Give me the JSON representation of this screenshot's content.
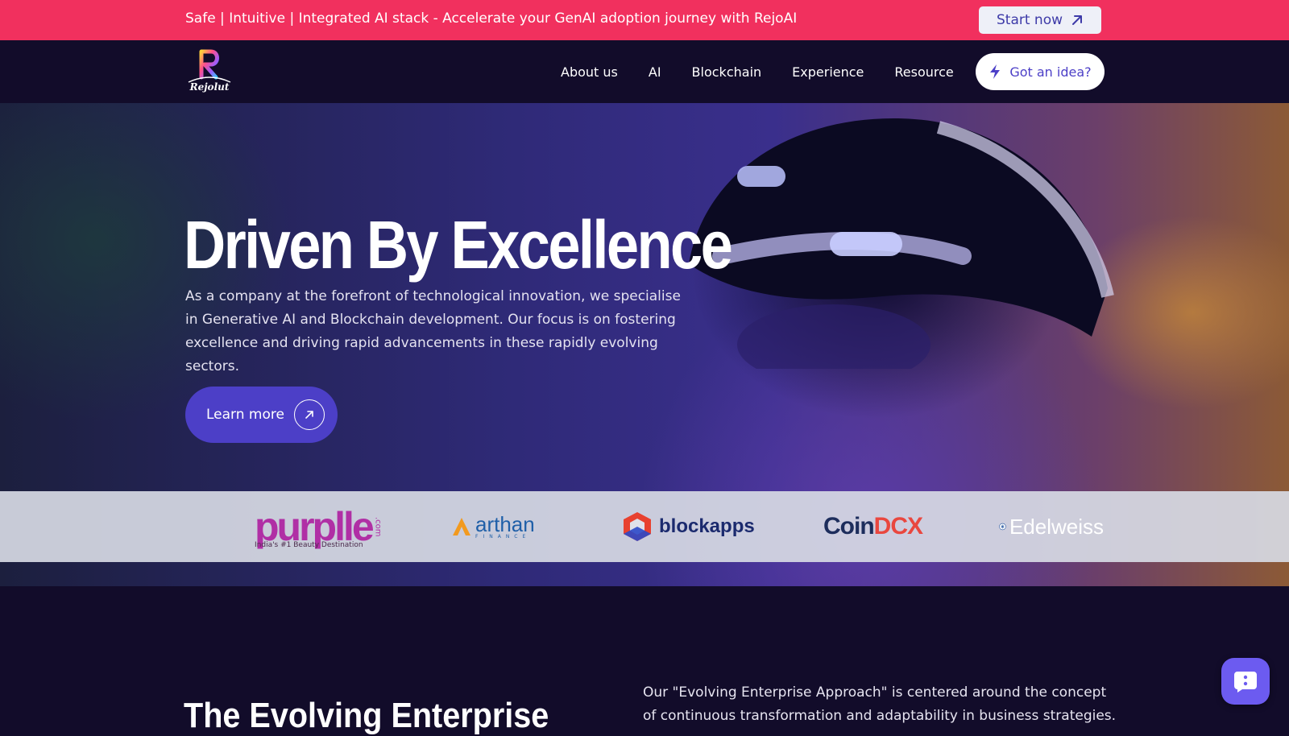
{
  "announcement": {
    "text": "Safe | Intuitive | Integrated AI stack - Accelerate your GenAI adoption journey with RejoAI",
    "cta_label": "Start now",
    "cta_icon": "arrow-up-right-icon"
  },
  "header": {
    "logo_text": "Rejolut",
    "nav": [
      "About us",
      "AI",
      "Blockchain",
      "Experience",
      "Resource"
    ],
    "cta_label": "Got an idea?",
    "cta_icon": "lightning-icon"
  },
  "hero": {
    "title": "Driven By Excellence",
    "description": "As a company at the forefront of technological innovation, we specialise in Generative AI and Blockchain development. Our focus is on fostering excellence and driving rapid advancements in these rapidly evolving sectors.",
    "button_label": "Learn more",
    "button_icon": "arrow-up-right-icon"
  },
  "clients": {
    "purplle": {
      "name": "purplle",
      "suffix": ".com",
      "tagline": "India's #1 Beauty Destination"
    },
    "arthan": {
      "name": "arthan",
      "sub": "FINANCE"
    },
    "blockapps": {
      "name": "blockapps"
    },
    "coindcx": {
      "part1": "Coin",
      "part2": "DCX"
    },
    "edelweiss": {
      "name": "Edelweiss"
    }
  },
  "section": {
    "title": "The Evolving Enterprise",
    "description": "Our \"Evolving Enterprise Approach\" is centered around the concept of continuous transformation and adaptability in business strategies."
  },
  "colors": {
    "announcement_bg": "#f1305e",
    "accent": "#4c3fc7",
    "page_bg": "#120c2a",
    "chat_button": "#6c5bf0"
  },
  "chat_widget": {
    "icon": "chat-bubble-icon"
  }
}
